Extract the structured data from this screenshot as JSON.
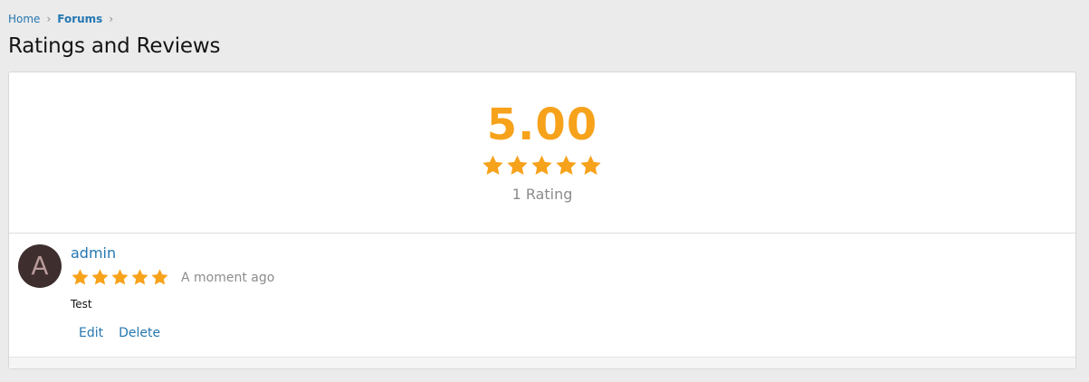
{
  "breadcrumb": {
    "home": "Home",
    "forums": "Forums",
    "separator": "›"
  },
  "page": {
    "title": "Ratings and Reviews"
  },
  "summary": {
    "average": "5.00",
    "stars": 5,
    "count_label": "1 Rating"
  },
  "review": {
    "avatar_letter": "A",
    "username": "admin",
    "stars": 5,
    "time": "A moment ago",
    "text": "Test",
    "edit_label": "Edit",
    "delete_label": "Delete"
  },
  "colors": {
    "accent": "#2577b1",
    "star": "#f7a21b",
    "avatar_bg": "#3e2e2e"
  }
}
